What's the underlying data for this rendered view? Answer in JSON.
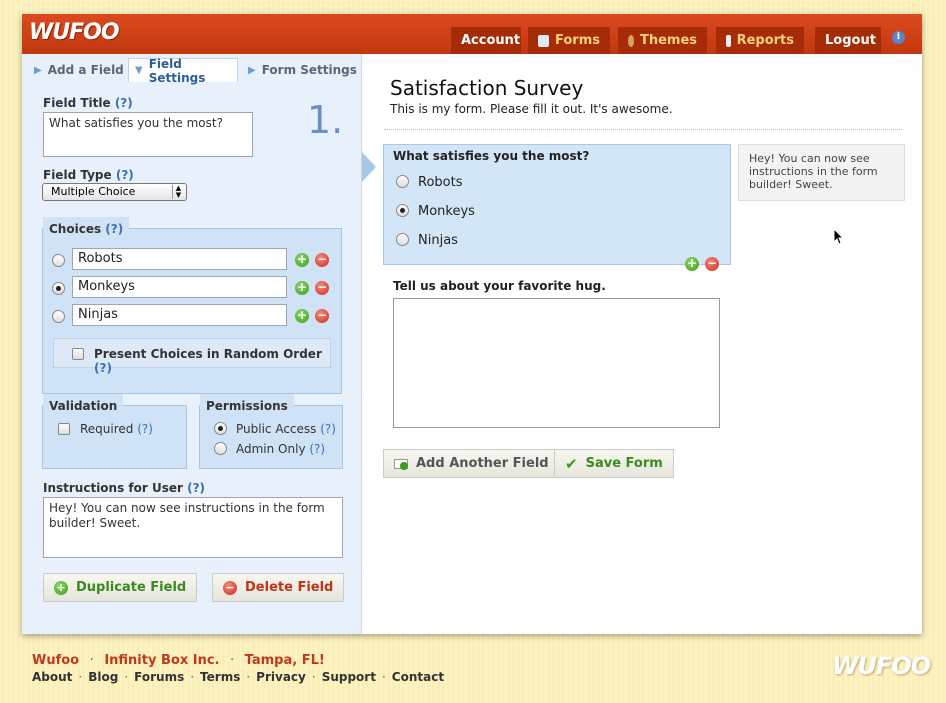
{
  "brand": "WUFOO",
  "nav": {
    "account": "Account",
    "forms": "Forms",
    "themes": "Themes",
    "reports": "Reports",
    "logout": "Logout",
    "info": "i"
  },
  "subtabs": {
    "add_field": "Add a Field",
    "field_settings": "Field Settings",
    "form_settings": "Form Settings"
  },
  "field_settings": {
    "field_title_label": "Field Title",
    "help": "(?)",
    "field_title_value": "What satisfies you the most?",
    "field_number": "1.",
    "field_type_label": "Field Type",
    "field_type_value": "Multiple Choice",
    "choices_label": "Choices",
    "choices": [
      {
        "value": "Robots",
        "selected": false
      },
      {
        "value": "Monkeys",
        "selected": true
      },
      {
        "value": "Ninjas",
        "selected": false
      }
    ],
    "random_order_label": "Present Choices in Random Order",
    "validation_label": "Validation",
    "required_label": "Required",
    "permissions_label": "Permissions",
    "public_access": "Public Access",
    "admin_only": "Admin Only",
    "instructions_label": "Instructions for User",
    "instructions_value": "Hey! You can now see instructions in the form builder! Sweet.",
    "duplicate_button": "Duplicate Field",
    "delete_button": "Delete Field"
  },
  "form": {
    "title": "Satisfaction Survey",
    "description": "This is my form. Please fill it out. It's awesome.",
    "q1": "What satisfies you the most?",
    "q1_options": [
      "Robots",
      "Monkeys",
      "Ninjas"
    ],
    "q1_selected": "Monkeys",
    "instructions_preview": "Hey! You can now see instructions in the form builder! Sweet.",
    "q2": "Tell us about your favorite hug.",
    "add_field_button": "Add Another Field",
    "save_button": "Save Form"
  },
  "footer": {
    "line1": [
      "Wufoo",
      "Infinity Box Inc.",
      "Tampa, FL!"
    ],
    "links": [
      "About",
      "Blog",
      "Forums",
      "Terms",
      "Privacy",
      "Support",
      "Contact"
    ],
    "logo": "WUFOO"
  },
  "colors": {
    "header_red": "#c1380f",
    "tab_dark": "#a52c07",
    "panel_blue": "#cfe2f6",
    "green": "#3a9b1c",
    "red": "#cf2a1a"
  }
}
